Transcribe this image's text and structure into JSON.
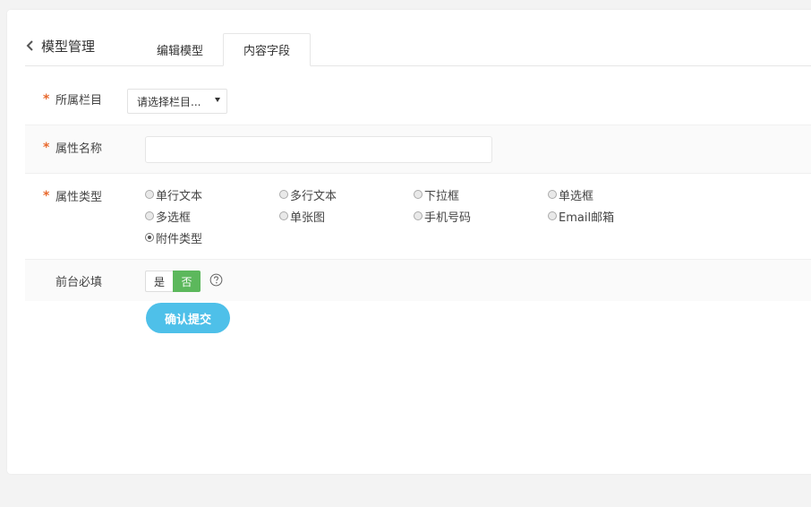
{
  "header": {
    "back_label": "模型管理",
    "tabs": [
      {
        "label": "编辑模型"
      },
      {
        "label": "内容字段"
      }
    ]
  },
  "form": {
    "category": {
      "label": "所属栏目",
      "required_mark": "*",
      "selected": "请选择栏目..."
    },
    "attr_name": {
      "label": "属性名称",
      "required_mark": "*",
      "value": "",
      "placeholder": ""
    },
    "attr_type": {
      "label": "属性类型",
      "required_mark": "*",
      "options": [
        {
          "label": "单行文本",
          "checked": false
        },
        {
          "label": "多行文本",
          "checked": false
        },
        {
          "label": "下拉框",
          "checked": false
        },
        {
          "label": "单选框",
          "checked": false
        },
        {
          "label": "多选框",
          "checked": false
        },
        {
          "label": "单张图",
          "checked": false
        },
        {
          "label": "手机号码",
          "checked": false
        },
        {
          "label": "Email邮箱",
          "checked": false
        },
        {
          "label": "附件类型",
          "checked": true
        }
      ]
    },
    "required_toggle": {
      "label": "前台必填",
      "yes_label": "是",
      "no_label": "否",
      "selected": "否"
    },
    "submit_label": "确认提交"
  },
  "colors": {
    "required_mark": "#e8692d",
    "toggle_active": "#5cb85c",
    "submit": "#4ec0e9"
  }
}
